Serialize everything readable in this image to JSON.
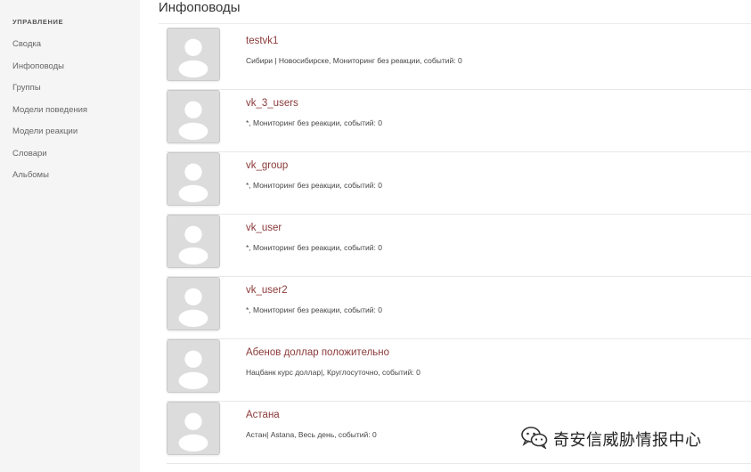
{
  "sidebar": {
    "header": "УПРАВЛЕНИЕ",
    "items": [
      {
        "label": "Сводка"
      },
      {
        "label": "Инфоповоды"
      },
      {
        "label": "Группы"
      },
      {
        "label": "Модели поведения"
      },
      {
        "label": "Модели реакции"
      },
      {
        "label": "Словари"
      },
      {
        "label": "Альбомы"
      }
    ]
  },
  "main": {
    "title": "Инфоповоды",
    "cards": [
      {
        "name": "testvk1",
        "meta": "Сибири | Новосибирске, Мониторинг без реакции, событий: 0"
      },
      {
        "name": "vk_3_users",
        "meta": "*, Мониторинг без реакции, событий: 0"
      },
      {
        "name": "vk_group",
        "meta": "*, Мониторинг без реакции, событий: 0"
      },
      {
        "name": "vk_user",
        "meta": "*, Мониторинг без реакции, событий: 0"
      },
      {
        "name": "vk_user2",
        "meta": "*, Мониторинг без реакции, событий: 0"
      },
      {
        "name": "Абенов доллар положительно",
        "meta": "Нацбанк курс доллар|, Круглосуточно, событий: 0"
      },
      {
        "name": "Астана",
        "meta": "Астан| Astana, Весь день, событий: 0"
      }
    ]
  },
  "watermark": {
    "text": "奇安信威胁情报中心",
    "icon": "wechat-icon"
  },
  "colors": {
    "link": "#8b3a3a",
    "sidebar_bg": "#f5f5f5",
    "avatar_bg": "#dcdcdc"
  }
}
